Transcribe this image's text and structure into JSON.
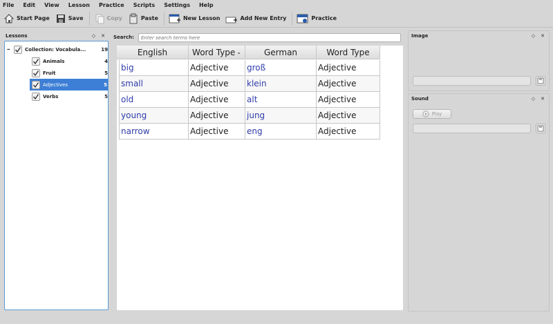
{
  "menu": [
    "File",
    "Edit",
    "View",
    "Lesson",
    "Practice",
    "Scripts",
    "Settings",
    "Help"
  ],
  "toolbar": {
    "start_page": "Start Page",
    "save": "Save",
    "copy": "Copy",
    "paste": "Paste",
    "new_lesson": "New Lesson",
    "add_new_entry": "Add New Entry",
    "practice": "Practice"
  },
  "lessons": {
    "title": "Lessons",
    "collection": {
      "label": "Collection: Vocabula...",
      "count": "19"
    },
    "items": [
      {
        "label": "Animals",
        "count": "4"
      },
      {
        "label": "Fruit",
        "count": "5"
      },
      {
        "label": "Adjectives",
        "count": "5"
      },
      {
        "label": "Verbs",
        "count": "5"
      }
    ]
  },
  "search": {
    "label": "Search:",
    "placeholder": "Enter search terms here"
  },
  "table": {
    "headers": [
      "English",
      "Word Type",
      "German",
      "Word Type"
    ],
    "rows": [
      [
        "big",
        "Adjective",
        "groß",
        "Adjective"
      ],
      [
        "small",
        "Adjective",
        "klein",
        "Adjective"
      ],
      [
        "old",
        "Adjective",
        "alt",
        "Adjective"
      ],
      [
        "young",
        "Adjective",
        "jung",
        "Adjective"
      ],
      [
        "narrow",
        "Adjective",
        "eng",
        "Adjective"
      ]
    ]
  },
  "image_panel": {
    "title": "Image"
  },
  "sound_panel": {
    "title": "Sound",
    "play_label": "Play"
  },
  "colors": {
    "accent": "#3d7fd6",
    "link_text": "#2f3cab"
  }
}
